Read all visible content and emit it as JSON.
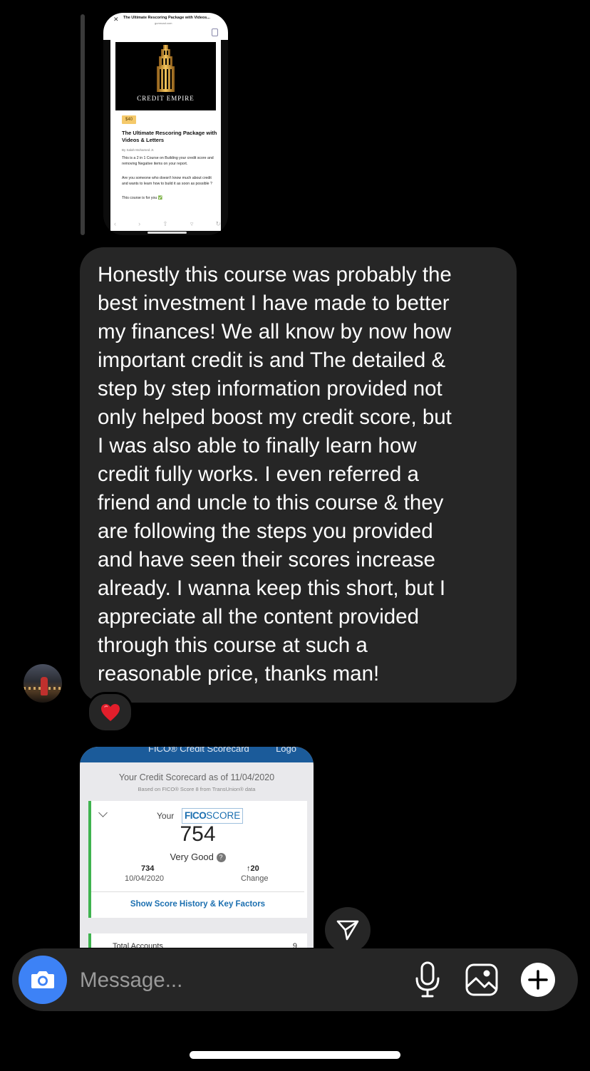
{
  "shared_post": {
    "browser_title": "The Ultimate Rescoring Package with Videos...",
    "browser_url": "gumroad.com",
    "brand": "CREDIT EMPIRE",
    "price": "$40",
    "heading": "The Ultimate Rescoring Package with Videos & Letters",
    "author": "By  Salah Mohamed Jr.",
    "desc1": "This is a 2 in 1 Course on Building your credit score and removing Negative items on your report.",
    "desc2": "Are you someone who doesn't know much about credit and wants to learn how to build it as soon as possible ?",
    "desc3": "This course is for you ✅"
  },
  "message": {
    "text": "Honestly this course was probably the\nbest investment I have made to better\nmy finances!  We all know by now how\nimportant credit is and The detailed &\nstep by step information provided not\nonly helped boost my credit score, but\nI was also able to finally learn how\ncredit fully works. I even referred a\nfriend and uncle to this course & they\nare following the steps you provided\nand have seen their scores increase\nalready. I wanna keep this short, but I\nappreciate all the content provided\nthrough this course at such a\nreasonable price, thanks man!",
    "reaction": "❤️"
  },
  "fico_screenshot": {
    "header_title": "FICO® Credit Scorecard",
    "header_right": "Logo",
    "scorecard_as_of": "Your Credit Scorecard as of 11/04/2020",
    "based_on": "Based on FICO® Score 8 from TransUnion® data",
    "your_label": "Your",
    "logo_bold": "FICO",
    "logo_light": "SCORE",
    "score": "754",
    "rating": "Very Good",
    "help": "?",
    "previous_score": "734",
    "previous_date": "10/04/2020",
    "change_value": "↑20",
    "change_label": "Change",
    "link": "Show Score History & Key Factors",
    "next_card_label": "Total Accounts",
    "next_card_value": "9"
  },
  "composer": {
    "placeholder": "Message..."
  },
  "colors": {
    "bubble": "#262626",
    "camera": "#3d82f6",
    "fico_blue": "#1b5b9a",
    "fico_green": "#3fb34f"
  },
  "icons": [
    "camera-icon",
    "microphone-icon",
    "gallery-icon",
    "plus-icon",
    "send-icon",
    "heart-icon"
  ]
}
